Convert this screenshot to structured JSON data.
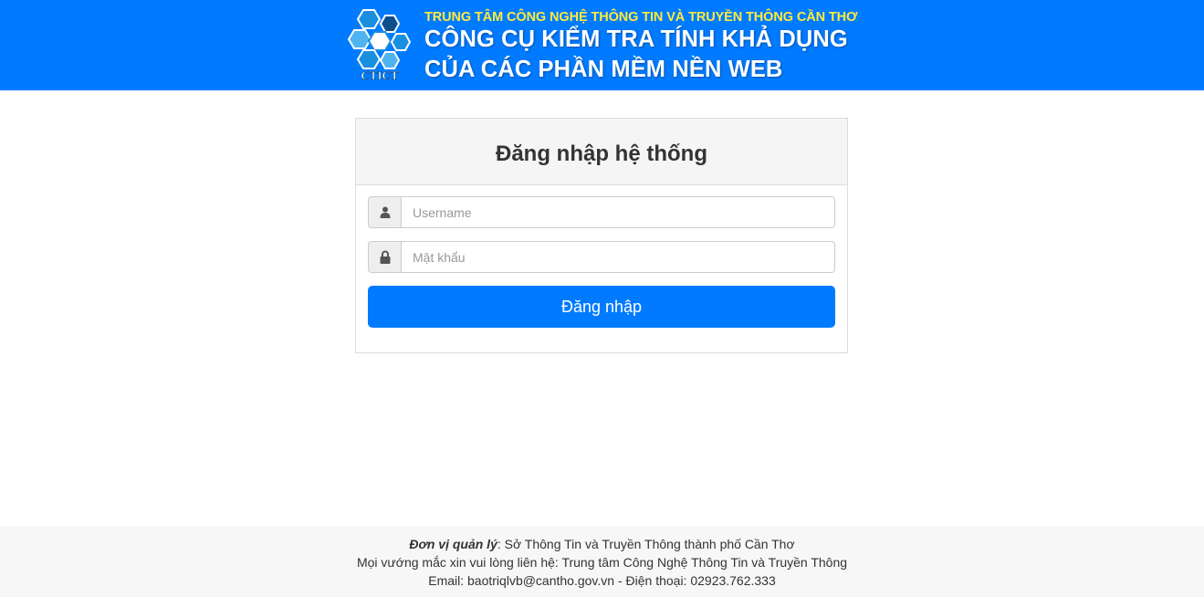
{
  "header": {
    "logo_text": "CTICT",
    "organization": "TRUNG TÂM CÔNG NGHỆ THÔNG TIN VÀ TRUYỀN THÔNG CẦN THƠ",
    "title_line1": "CÔNG CỤ KIỂM TRA TÍNH KHẢ DỤNG",
    "title_line2": "CỦA CÁC PHẦN MỀM NỀN WEB",
    "colors": {
      "bar": "#007bff",
      "organization": "#ffeb3b",
      "title": "#ffffff"
    }
  },
  "login": {
    "title": "Đăng nhập hệ thống",
    "username": {
      "value": "",
      "placeholder": "Username",
      "icon": "user-icon"
    },
    "password": {
      "value": "",
      "placeholder": "Mật khẩu",
      "icon": "lock-icon"
    },
    "submit_label": "Đăng nhập",
    "colors": {
      "button": "#007bff"
    }
  },
  "footer": {
    "manager_label": "Đơn vị quản lý",
    "manager_value": ": Sở Thông Tin và Truyền Thông thành phố Cần Thơ",
    "contact_line": "Mọi vướng mắc xin vui lòng liên hệ: Trung tâm Công Nghệ Thông Tin và Truyền Thông",
    "email_phone": "Email: baotriqlvb@cantho.gov.vn - Điện thoại: 02923.762.333"
  }
}
